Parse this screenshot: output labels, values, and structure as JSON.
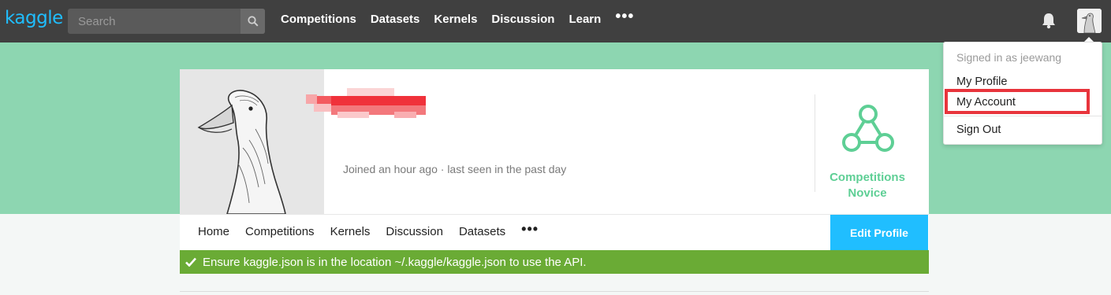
{
  "topbar": {
    "logo": "kaggle",
    "search_placeholder": "Search",
    "nav": [
      "Competitions",
      "Datasets",
      "Kernels",
      "Discussion",
      "Learn"
    ],
    "nav_more": "•••",
    "icons": {
      "search": "search-icon",
      "bell": "bell-icon",
      "avatar": "goose-avatar"
    }
  },
  "profile": {
    "joined": "Joined an hour ago · last seen in the past day",
    "tier_line1": "Competitions",
    "tier_line2": "Novice",
    "tabs": [
      "Home",
      "Competitions",
      "Kernels",
      "Discussion",
      "Datasets"
    ],
    "tabs_more": "•••",
    "edit_button": "Edit Profile"
  },
  "banner": {
    "text": "Ensure kaggle.json is in the location ~/.kaggle/kaggle.json to use the API."
  },
  "dropdown": {
    "signed_in": "Signed in as jeewang",
    "items": [
      "My Profile",
      "My Account",
      "Sign Out"
    ]
  },
  "colors": {
    "topbar": "#404040",
    "accent": "#20beff",
    "hero": "#8dd6b1",
    "tier": "#5ecf95",
    "success": "#6aab35",
    "highlight": "#e8343c"
  }
}
